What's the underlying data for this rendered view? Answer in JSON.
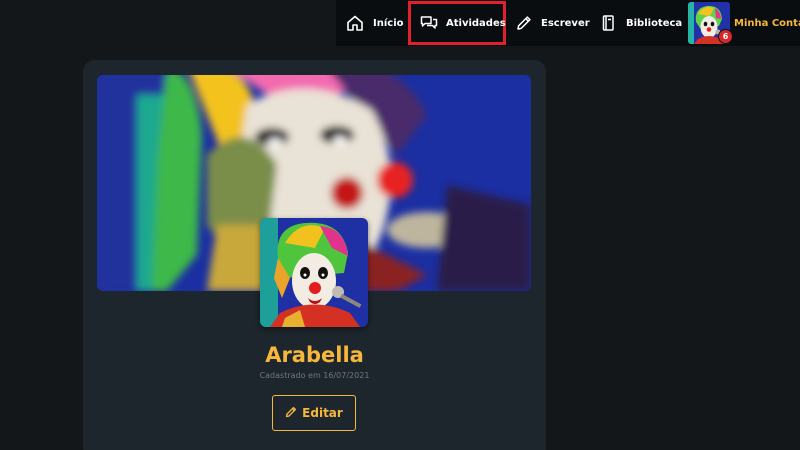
{
  "nav": {
    "items": [
      {
        "label": "Início",
        "icon": "home-icon"
      },
      {
        "label": "Atividades",
        "icon": "chat-bubbles-icon",
        "highlighted": true
      },
      {
        "label": "Escrever",
        "icon": "pencil-icon"
      },
      {
        "label": "Biblioteca",
        "icon": "book-icon"
      }
    ],
    "account": {
      "label": "Minha Conta",
      "notification_count": "6"
    }
  },
  "profile": {
    "name": "Arabella",
    "registered": "Cadastrado em 16/07/2021",
    "edit_label": "Editar"
  },
  "colors": {
    "accent": "#f6b73c",
    "highlight_box": "#e0202b",
    "badge": "#d42a2a",
    "card_bg": "#1d262c",
    "page_bg": "#13171a",
    "nav_bg": "#0a0d10"
  }
}
